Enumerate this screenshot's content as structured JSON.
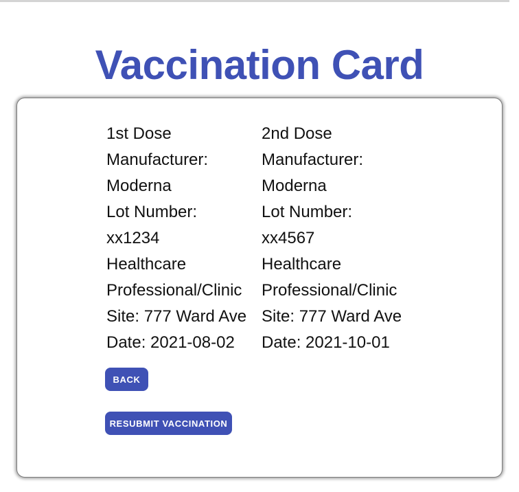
{
  "page": {
    "title": "Vaccination Card"
  },
  "doses": [
    {
      "heading": "1st Dose",
      "manufacturer_label": "Manufacturer:",
      "manufacturer": "Moderna",
      "lot_label": "Lot Number:",
      "lot": "xx1234",
      "provider_label_line1": "Healthcare",
      "provider_label_line2": "Professional/Clinic",
      "site": "Site: 777 Ward Ave",
      "date": "Date: 2021-08-02"
    },
    {
      "heading": "2nd Dose",
      "manufacturer_label": "Manufacturer:",
      "manufacturer": "Moderna",
      "lot_label": "Lot Number:",
      "lot": "xx4567",
      "provider_label_line1": "Healthcare",
      "provider_label_line2": "Professional/Clinic",
      "site": "Site: 777 Ward Ave",
      "date": "Date: 2021-10-01"
    }
  ],
  "actions": {
    "back_label": "BACK",
    "resubmit_label": "RESUBMIT VACCINATION"
  },
  "colors": {
    "accent": "#3f51b5"
  }
}
